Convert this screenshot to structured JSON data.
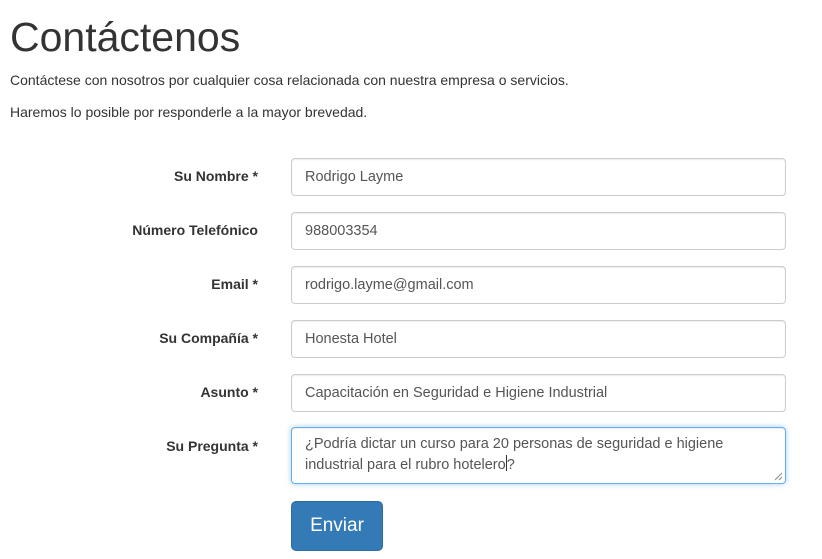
{
  "page": {
    "title": "Contáctenos",
    "intro_line1": "Contáctese con nosotros por cualquier cosa relacionada con nuestra empresa o servicios.",
    "intro_line2": "Haremos lo posible por responderle a la mayor brevedad."
  },
  "form": {
    "fields": [
      {
        "label": "Su Nombre *",
        "value": "Rodrigo Layme"
      },
      {
        "label": "Número Telefónico",
        "value": "988003354"
      },
      {
        "label": "Email *",
        "value": "rodrigo.layme@gmail.com"
      },
      {
        "label": "Su Compañía *",
        "value": "Honesta Hotel"
      },
      {
        "label": "Asunto *",
        "value": "Capacitación en Seguridad e Higiene Industrial"
      },
      {
        "label": "Su Pregunta *",
        "value_before_cursor": "¿Podría dictar un curso para 20 personas de seguridad e higiene industrial para el rubro hotelero",
        "value_after_cursor": "?"
      }
    ],
    "submit_label": "Enviar",
    "accent_color": "#337ab7"
  }
}
